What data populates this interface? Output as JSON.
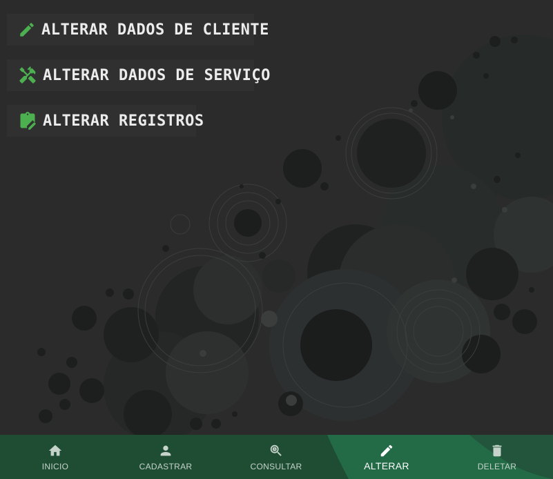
{
  "colors": {
    "accent": "#4caf50",
    "background": "#2b2b2b",
    "button_bg": "#303030",
    "nav_bg": "#1e4d33",
    "nav_active_bg": "#236b47"
  },
  "menu": {
    "items": [
      {
        "label": "ALTERAR DADOS DE CLIENTE",
        "icon": "pencil-icon"
      },
      {
        "label": "ALTERAR DADOS DE SERVIÇO",
        "icon": "tools-icon"
      },
      {
        "label": "ALTERAR REGISTROS",
        "icon": "clipboard-edit-icon"
      }
    ]
  },
  "bottom_nav": {
    "active": "ALTERAR",
    "items": [
      {
        "label": "INICIO",
        "icon": "home-icon"
      },
      {
        "label": "CADASTRAR",
        "icon": "person-icon"
      },
      {
        "label": "CONSULTAR",
        "icon": "search-globe-icon"
      },
      {
        "label": "ALTERAR",
        "icon": "pencil-icon"
      },
      {
        "label": "DELETAR",
        "icon": "trash-icon"
      }
    ]
  }
}
